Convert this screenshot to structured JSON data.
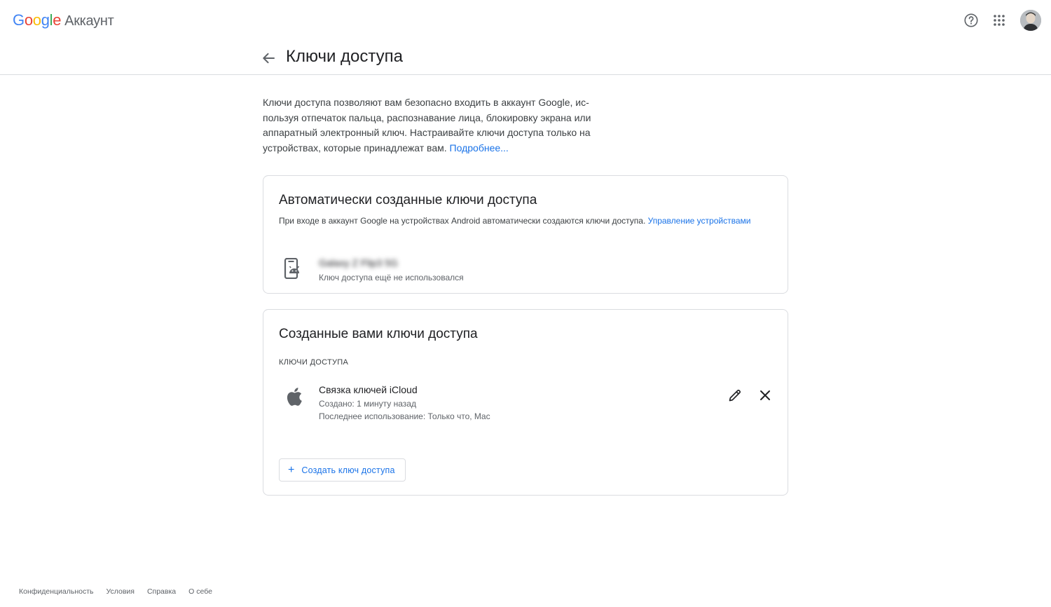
{
  "header": {
    "logo": {
      "letters": [
        "G",
        "o",
        "o",
        "g",
        "l",
        "e"
      ],
      "product": "Аккаунт"
    },
    "icons": [
      "help-icon",
      "apps-grid-icon",
      "avatar"
    ]
  },
  "page": {
    "title": "Ключи доступа",
    "intro_text": "Ключи доступа позволяют вам безопасно входить в аккаунт Google, ис­пользуя отпечаток пальца, распознавание лица, блокировку экрана или аппаратный электронный ключ. Настраивайте ключи доступа только на устройствах, которые принадлежат вам. ",
    "intro_link": "Подробнее..."
  },
  "auto_card": {
    "title": "Автоматически созданные ключи доступа",
    "description": "При входе в аккаунт Google на устройствах Android автоматически создаются ключи доступа. ",
    "manage_link": "Управление устройства­ми",
    "device": {
      "name": "Galaxy Z Flip3 5G",
      "status": "Ключ доступа ещё не использовался"
    }
  },
  "my_card": {
    "title": "Созданные вами ключи доступа",
    "section_label": "КЛЮЧИ ДОСТУПА",
    "passkey": {
      "name": "Связка ключей iCloud",
      "created": "Создано: 1 минуту назад",
      "last_used": "Последнее использование: Только что, Mac"
    },
    "create_button": "Создать ключ доступа"
  },
  "footer": {
    "links": [
      "Конфиденциальность",
      "Условия",
      "Справка",
      "О себе"
    ]
  },
  "colors": {
    "link_blue": "#1a73e8",
    "border": "#dadce0",
    "text_secondary": "#5f6368"
  }
}
